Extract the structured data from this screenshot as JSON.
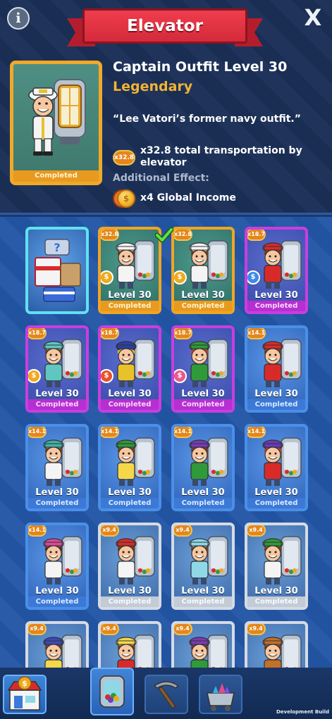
{
  "header": {
    "title": "Elevator",
    "info_label": "i",
    "close_label": "X"
  },
  "selected_item": {
    "name": "Captain Outfit Level 30",
    "rarity": "Legendary",
    "quote": "“Lee Vatori’s former navy outfit.”",
    "status": "Completed",
    "multiplier": "x32.8",
    "bonus_text": "x32.8 total transportation by elevator",
    "additional_effect_label": "Additional Effect:",
    "additional_effect": "x4 Global Income"
  },
  "cards": [
    {
      "type": "chest",
      "rarity": "chest"
    },
    {
      "mult": "x32.8",
      "rarity": "legendary",
      "level": "Level 30",
      "status": "Completed",
      "coin": "#f0a91c",
      "hat": "#f4f4f4",
      "shirt": "#f4f4f4",
      "hair": "#7b3d12",
      "selected": true
    },
    {
      "mult": "x32.8",
      "rarity": "legendary",
      "level": "Level 30",
      "status": "Completed",
      "coin": "#f0a91c",
      "hat": "#f4f4f4",
      "shirt": "#f4f4f4",
      "hair": "#7b3d12"
    },
    {
      "mult": "x18.7",
      "rarity": "epic",
      "level": "Level 30",
      "status": "Completed",
      "coin": "#3a8be8",
      "hat": "#d92a2a",
      "shirt": "#d92a2a",
      "hair": "#7b3d12"
    },
    {
      "mult": "x18.7",
      "rarity": "epic",
      "level": "Level 30",
      "status": "Completed",
      "coin": "#f0a91c",
      "hat": "#5fc7c0",
      "shirt": "#5fc7c0",
      "hair": "#7b3d12"
    },
    {
      "mult": "x18.7",
      "rarity": "epic",
      "level": "Level 30",
      "status": "Completed",
      "coin": "#e8522a",
      "hat": "#2a3fa8",
      "shirt": "#e8c22a",
      "hair": "#e8c22a"
    },
    {
      "mult": "x18.7",
      "rarity": "epic",
      "level": "Level 30",
      "status": "Completed",
      "coin": "#e85a8a",
      "hat": "#2f9a3a",
      "shirt": "#2f9a3a",
      "hair": "#d93a3a"
    },
    {
      "mult": "x14.1",
      "rarity": "rare",
      "level": "Level 30",
      "status": "Completed",
      "hat": "#d92a2a",
      "shirt": "#d92a2a",
      "hair": "#7b3d12"
    },
    {
      "mult": "x14.1",
      "rarity": "rare",
      "level": "Level 30",
      "status": "Completed",
      "hat": "#3fb0a8",
      "shirt": "#f4f4f4",
      "hair": "#7b3d12"
    },
    {
      "mult": "x14.1",
      "rarity": "rare",
      "level": "Level 30",
      "status": "Completed",
      "hat": "#2f9a3a",
      "shirt": "#f4d84a",
      "hair": "#7b3d12"
    },
    {
      "mult": "x14.1",
      "rarity": "rare",
      "level": "Level 30",
      "status": "Completed",
      "hat": "#7a3ab8",
      "shirt": "#2f9a3a",
      "hair": "#7b3d12"
    },
    {
      "mult": "x14.1",
      "rarity": "rare",
      "level": "Level 30",
      "status": "Completed",
      "hat": "#6a3ab8",
      "shirt": "#d92a2a",
      "hair": "#c2402a"
    },
    {
      "mult": "x14.1",
      "rarity": "rare",
      "level": "Level 30",
      "status": "Completed",
      "hat": "#d94a9a",
      "shirt": "#f4f4f4",
      "hair": "#5a2a10"
    },
    {
      "mult": "x9.4",
      "rarity": "common",
      "level": "Level 30",
      "status": "Completed",
      "hat": "#d92a2a",
      "shirt": "#f4f4f4",
      "hair": "#7b3d12"
    },
    {
      "mult": "x9.4",
      "rarity": "common",
      "level": "Level 30",
      "status": "Completed",
      "hat": "#8fd8e8",
      "shirt": "#8fd8e8",
      "hair": "#7b3d12"
    },
    {
      "mult": "x9.4",
      "rarity": "common",
      "level": "Level 30",
      "status": "Completed",
      "hat": "#2f9a3a",
      "shirt": "#f4f4f4",
      "hair": "#7b3d12"
    },
    {
      "mult": "x9.4",
      "rarity": "common",
      "hat": "#3a48b8",
      "shirt": "#f4d84a",
      "hair": "#7b3d12"
    },
    {
      "mult": "x9.4",
      "rarity": "common",
      "hat": "#f4d84a",
      "shirt": "#d92a2a",
      "hair": "#7b3d12"
    },
    {
      "mult": "x9.4",
      "rarity": "common",
      "hat": "#7a3ab8",
      "shirt": "#2f9a3a",
      "hair": "#7b3d12"
    },
    {
      "mult": "x9.4",
      "rarity": "common",
      "hat": "#c2702a",
      "shirt": "#c2702a",
      "hair": "#7b3d12"
    }
  ],
  "nav": {
    "tabs": [
      {
        "name": "shop",
        "icon": "shop-icon"
      },
      {
        "name": "outfits",
        "icon": "outfit-capsule-icon"
      },
      {
        "name": "tools",
        "icon": "pickaxe-icon"
      },
      {
        "name": "gems",
        "icon": "gem-cart-icon"
      }
    ],
    "dev_label": "Development Build"
  }
}
